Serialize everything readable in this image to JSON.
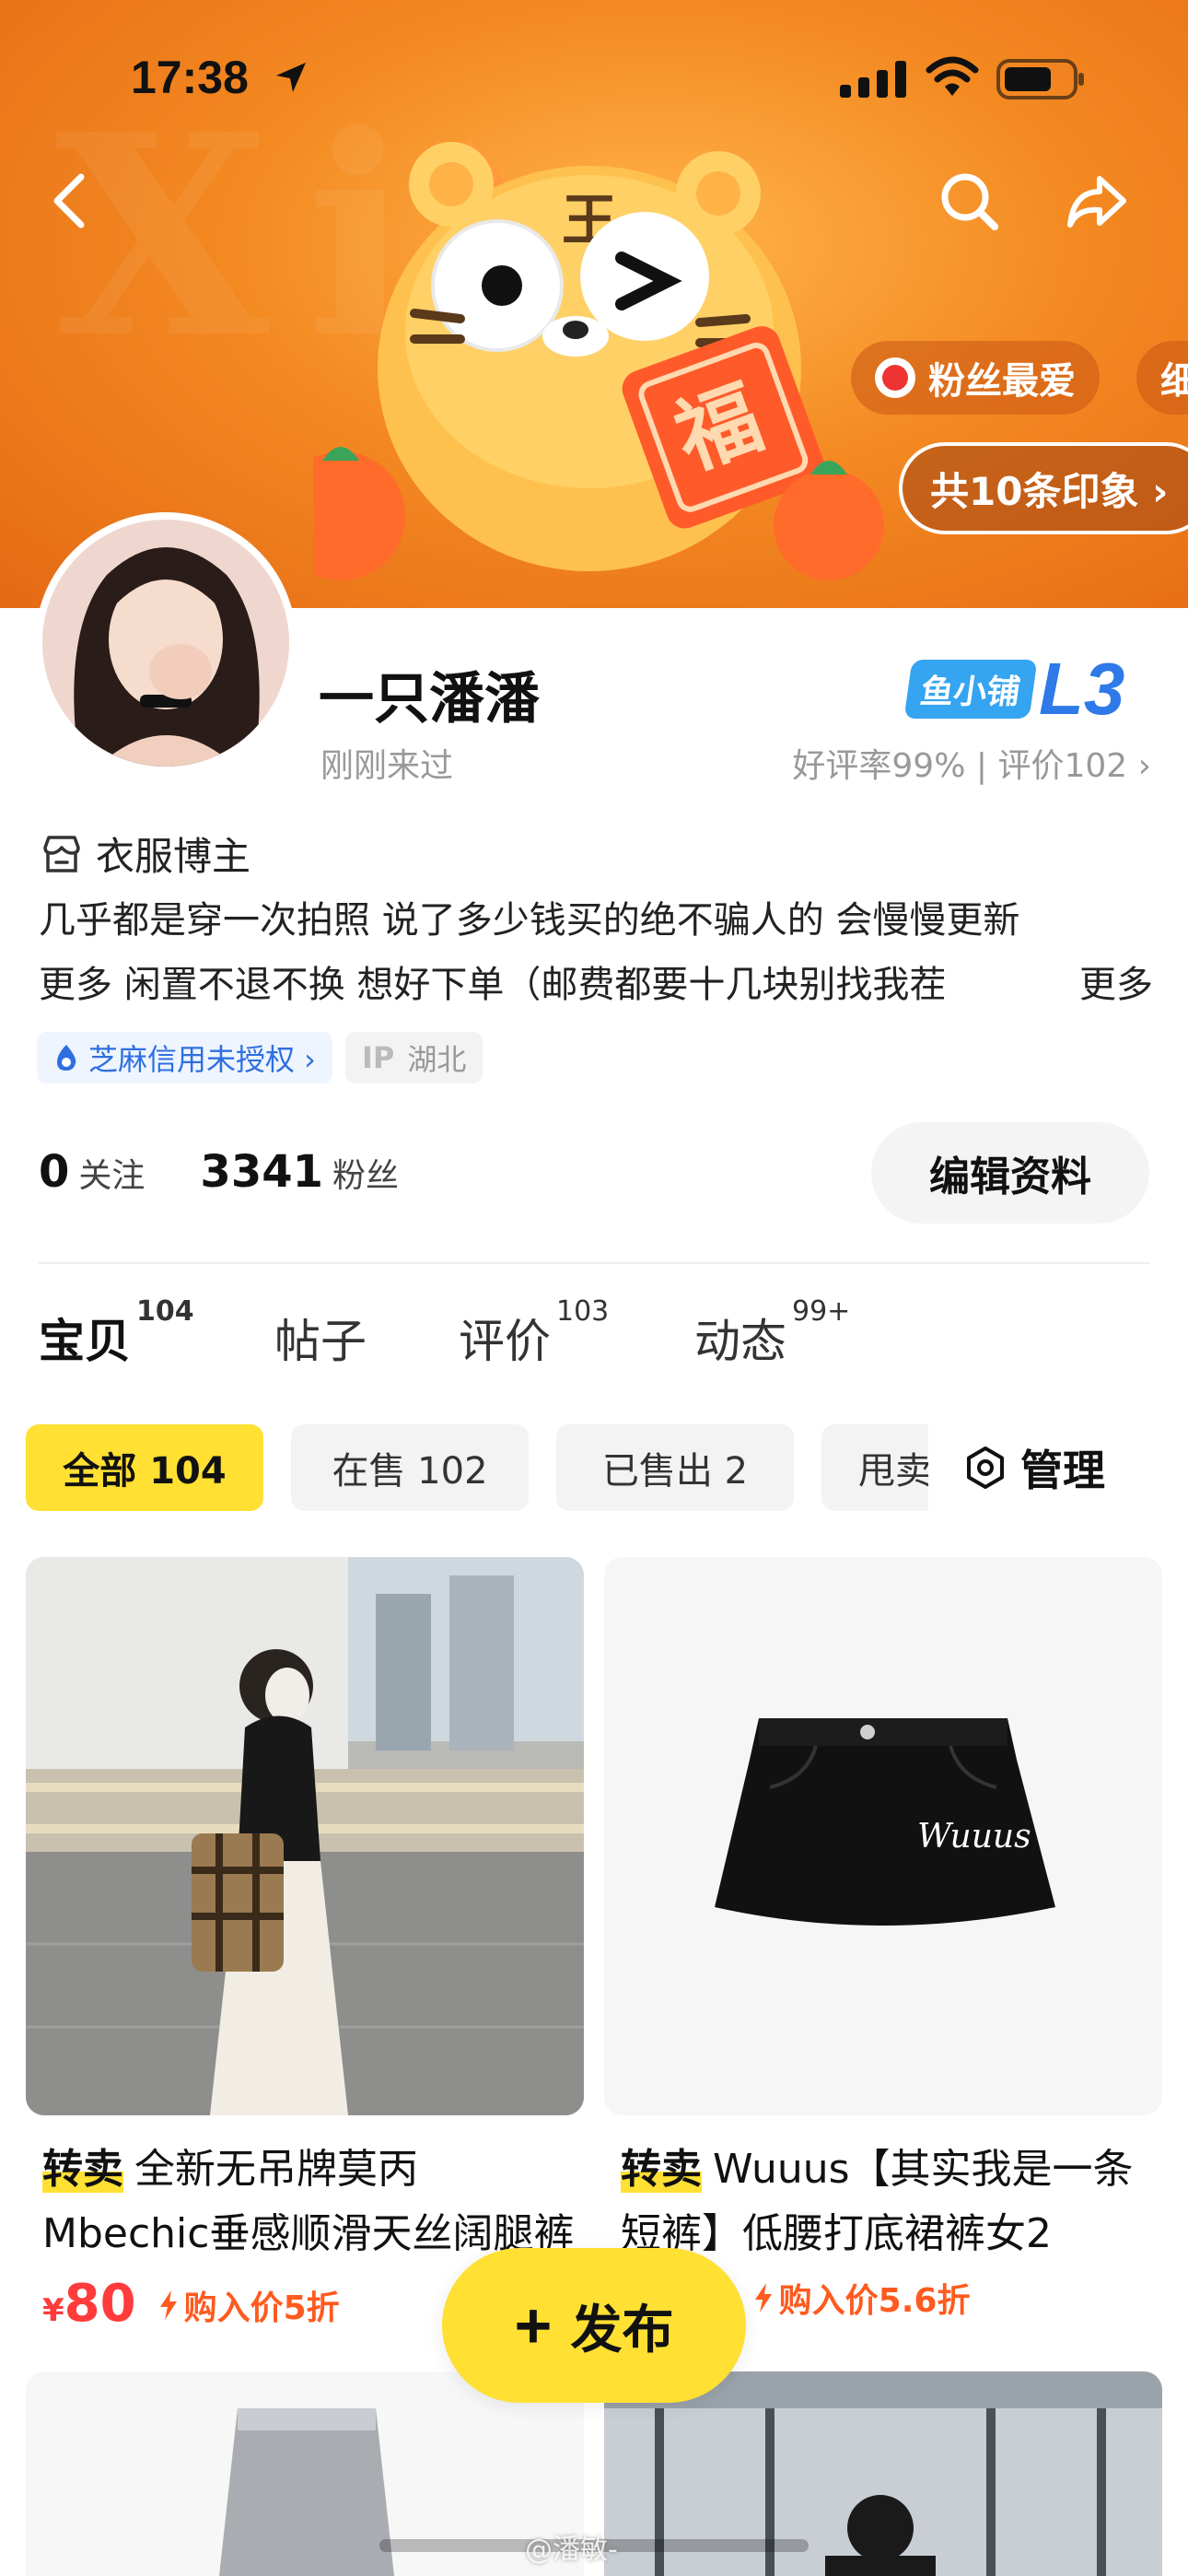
{
  "status_bar": {
    "time": "17:38"
  },
  "banner": {
    "tags": [
      "粉丝最爱",
      "细"
    ],
    "impressions": "共10条印象 ›"
  },
  "profile": {
    "username": "一只潘潘",
    "last_seen": "刚刚来过",
    "shop_badge": "鱼小铺",
    "shop_level": "L3",
    "rating": "好评率99% | 评价102 ›",
    "role": "衣服博主",
    "bio_line1": "几乎都是穿一次拍照 说了多少钱买的绝不骗人的 会慢慢更新",
    "bio_line2": "更多 闲置不退不换 想好下单（邮费都要十几块别找我茬",
    "bio_more": "更多",
    "zhima": "芝麻信用未授权 ›",
    "ip_key": "IP",
    "ip_value": "湖北"
  },
  "stats": {
    "following_count": "0",
    "following_label": "关注",
    "fans_count": "3341",
    "fans_label": "粉丝"
  },
  "edit_button": "编辑资料",
  "tabs": [
    {
      "label": "宝贝",
      "count": "104"
    },
    {
      "label": "帖子",
      "count": ""
    },
    {
      "label": "评价",
      "count": "103"
    },
    {
      "label": "动态",
      "count": "99+"
    }
  ],
  "filters": [
    "全部 104",
    "在售 102",
    "已售出 2",
    "甩卖"
  ],
  "manage": "管理",
  "products": [
    {
      "tag": "转卖",
      "title": "全新无吊牌莫丙Mbechic垂感顺滑天丝阔腿裤",
      "currency": "¥",
      "price": "80",
      "discount": "购入价5折"
    },
    {
      "tag": "转卖",
      "title": "Wuuus【其实我是一条短裤】低腰打底裙裤女2",
      "currency": "¥",
      "price": "",
      "discount": "购入价5.6折",
      "image_text": "Wuuus"
    }
  ],
  "publish_button": "发布",
  "watermark": "@潘敏-",
  "colors": {
    "accent": "#ffe033",
    "price": "#ff3b3b",
    "banner": "#f48a22",
    "link": "#2f6fe0"
  }
}
